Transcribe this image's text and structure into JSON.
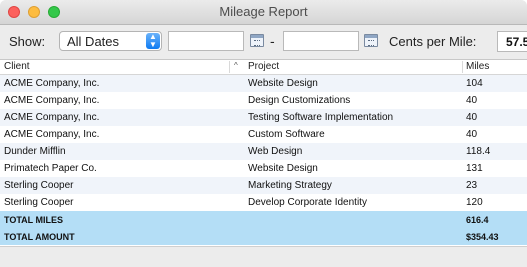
{
  "window": {
    "title": "Mileage Report"
  },
  "toolbar": {
    "show_label": "Show:",
    "show_value": "All Dates",
    "start_date": "",
    "end_date": "",
    "dash": "-",
    "cents_label": "Cents per Mile:",
    "cents_value": "57.5"
  },
  "table": {
    "columns": [
      "Client",
      "Project",
      "Miles"
    ],
    "rows": [
      [
        "ACME Company, Inc.",
        "Website Design",
        "104"
      ],
      [
        "ACME Company, Inc.",
        "Design Customizations",
        "40"
      ],
      [
        "ACME Company, Inc.",
        "Testing Software Implementation",
        "40"
      ],
      [
        "ACME Company, Inc.",
        "Custom Software",
        "40"
      ],
      [
        "Dunder Mifflin",
        "Web Design",
        "118.4"
      ],
      [
        "Primatech Paper Co.",
        "Website Design",
        "131"
      ],
      [
        "Sterling Cooper",
        "Marketing Strategy",
        "23"
      ],
      [
        "Sterling Cooper",
        "Develop Corporate Identity",
        "120"
      ]
    ],
    "totals": [
      [
        "TOTAL MILES",
        "",
        "616.4"
      ],
      [
        "TOTAL AMOUNT",
        "",
        "$354.43"
      ]
    ]
  },
  "icons": {
    "close": "close-button",
    "minimize": "minimize-button",
    "maximize": "zoom-button",
    "calendar": "calendar-icon",
    "select": "chevron-updown-icon"
  }
}
